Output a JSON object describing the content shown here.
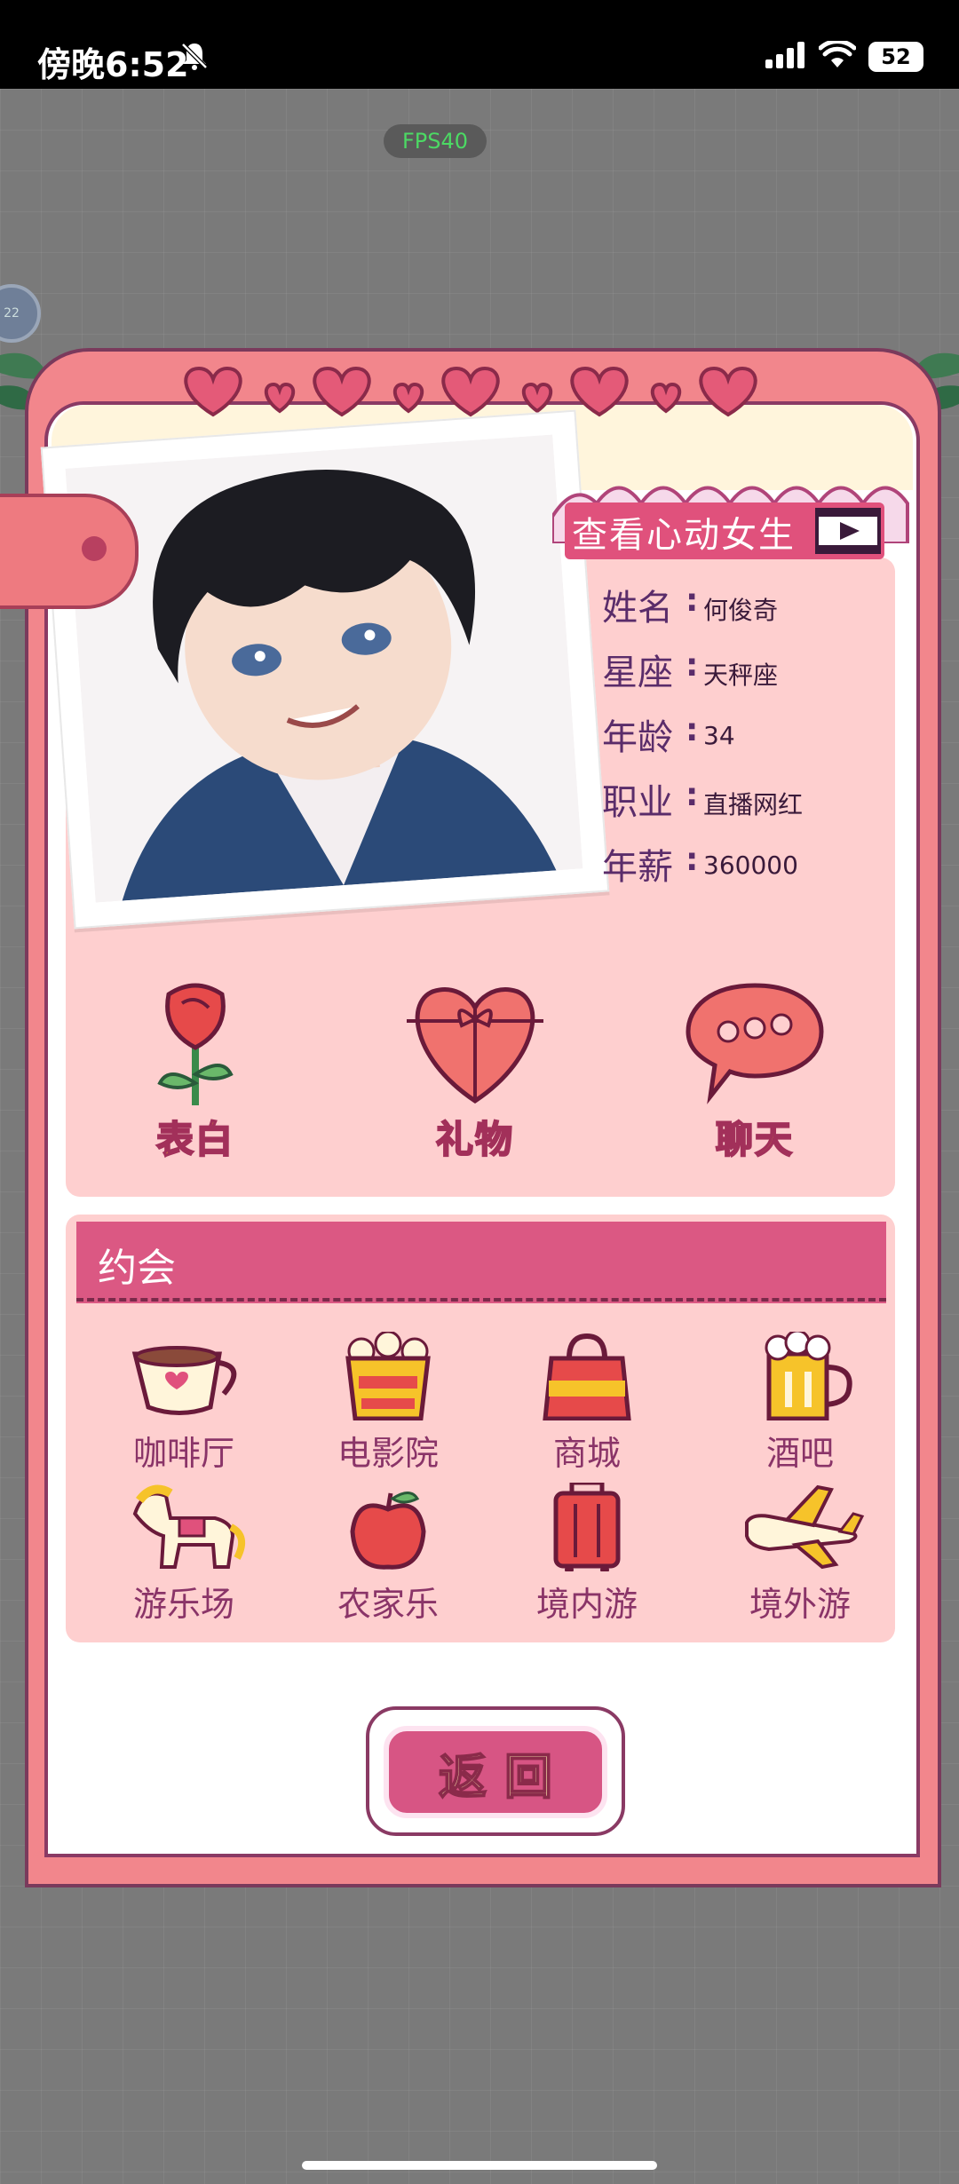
{
  "status_bar": {
    "time": "傍晚6:52",
    "battery": "52"
  },
  "overlay": {
    "fps": "FPS40",
    "side_badge": "22"
  },
  "profile": {
    "view_label": "查看心动女生",
    "fields": [
      {
        "label": "姓名",
        "value": "何俊奇"
      },
      {
        "label": "星座",
        "value": "天秤座"
      },
      {
        "label": "年龄",
        "value": "34"
      },
      {
        "label": "职业",
        "value": "直播网红"
      },
      {
        "label": "年薪",
        "value": "360000"
      }
    ]
  },
  "actions": [
    {
      "label": "表白",
      "icon": "rose-icon"
    },
    {
      "label": "礼物",
      "icon": "gift-heart-icon"
    },
    {
      "label": "聊天",
      "icon": "chat-bubble-icon"
    }
  ],
  "dating": {
    "title": "约会",
    "venues": [
      {
        "label": "咖啡厅",
        "icon": "coffee-cup-icon"
      },
      {
        "label": "电影院",
        "icon": "popcorn-icon"
      },
      {
        "label": "商城",
        "icon": "shopping-bag-icon"
      },
      {
        "label": "酒吧",
        "icon": "beer-mug-icon"
      },
      {
        "label": "游乐场",
        "icon": "carousel-horse-icon"
      },
      {
        "label": "农家乐",
        "icon": "apple-icon"
      },
      {
        "label": "境内游",
        "icon": "suitcase-icon"
      },
      {
        "label": "境外游",
        "icon": "airplane-icon"
      }
    ]
  },
  "return_label": "返回",
  "colors": {
    "card": "#f2868c",
    "panel": "#fecfcf",
    "header": "#db5883",
    "text": "#8a3468"
  }
}
